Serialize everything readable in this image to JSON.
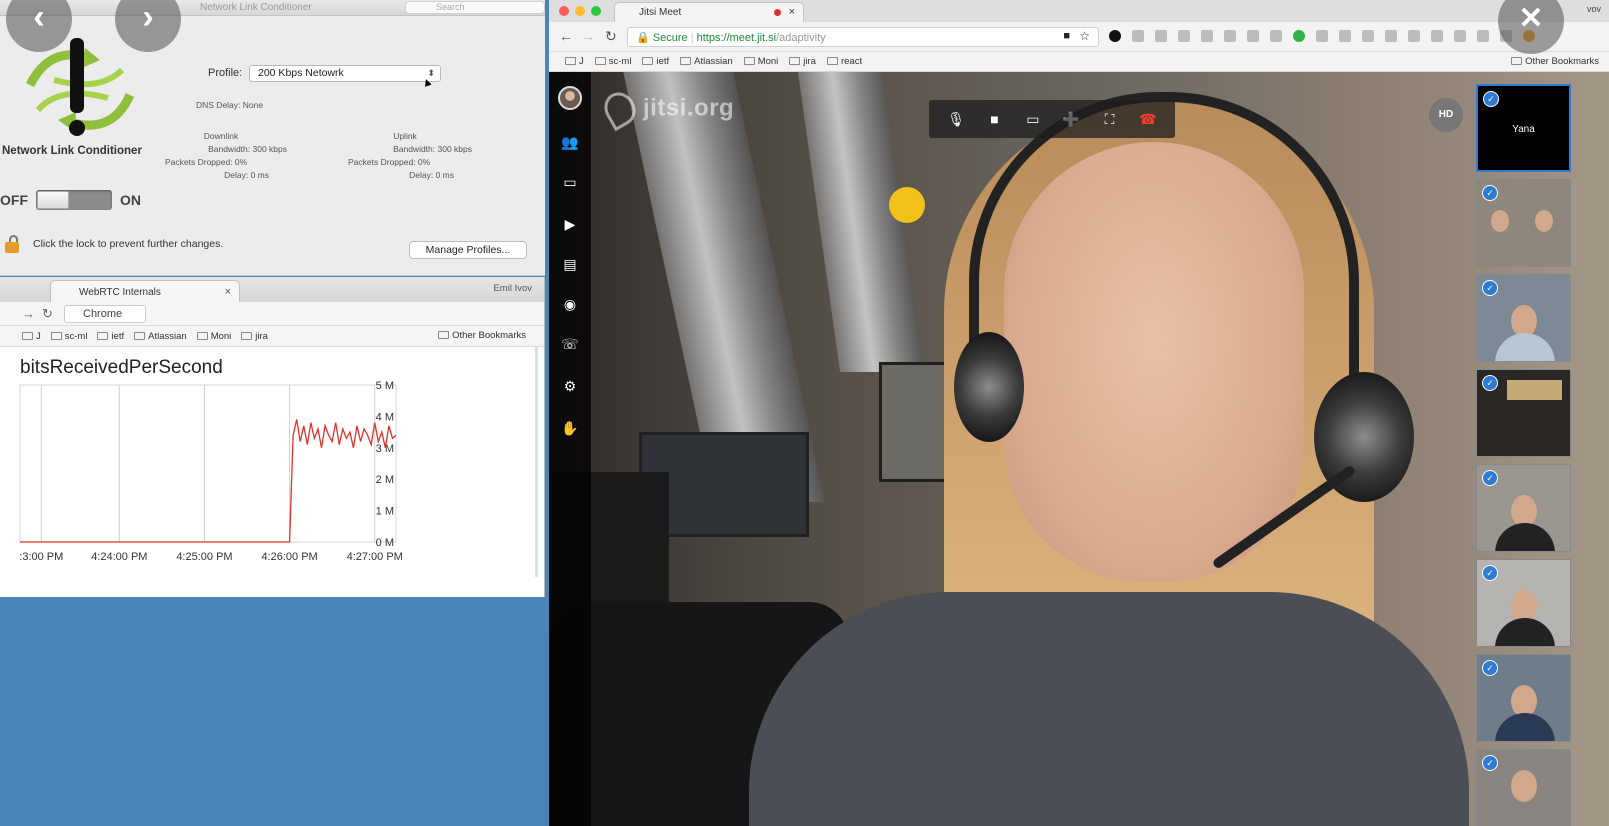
{
  "nlc": {
    "window_title": "Network Link Conditioner",
    "search_placeholder": "Search",
    "app_name": "Network Link Conditioner",
    "toggle_off": "OFF",
    "toggle_on": "ON",
    "profile_label": "Profile:",
    "profile_value": "200 Kbps Netowrk",
    "dns_delay": "DNS Delay: None",
    "downlink": {
      "title": "Downlink",
      "bandwidth": "Bandwidth: 300 kbps",
      "dropped": "Packets Dropped: 0%",
      "delay": "Delay: 0 ms"
    },
    "uplink": {
      "title": "Uplink",
      "bandwidth": "Bandwidth: 300 kbps",
      "dropped": "Packets Dropped: 0%",
      "delay": "Delay: 0 ms"
    },
    "lock_text": "Click the lock to prevent further changes.",
    "manage_profiles": "Manage Profiles..."
  },
  "webrtc": {
    "tab_title": "WebRTC Internals",
    "user": "Emil Ivov",
    "omnibox": "Chrome",
    "bookmarks": [
      "J",
      "sc-ml",
      "ietf",
      "Atlassian",
      "Moni",
      "jira"
    ],
    "other_bookmarks": "Other Bookmarks",
    "chart_title": "bitsReceivedPerSecond"
  },
  "chart_data": {
    "type": "line",
    "title": "bitsReceivedPerSecond",
    "x_tick_labels": [
      ":3:00 PM",
      "4:24:00 PM",
      "4:25:00 PM",
      "4:26:00 PM",
      "4:27:00 PM"
    ],
    "y_tick_labels": [
      "0 M",
      "1 M",
      "2 M",
      "3 M",
      "4 M",
      "5 M"
    ],
    "ylim": [
      0,
      5
    ],
    "grid": true,
    "series": [
      {
        "color": "#e0322b",
        "x": [
          0,
          0.5,
          1,
          1.5,
          2,
          2.5,
          3,
          3.5,
          3.8,
          3.85,
          3.9,
          3.95,
          4.0,
          4.05,
          4.1,
          4.15,
          4.2,
          4.25,
          4.3,
          4.35,
          4.4,
          4.45,
          4.5,
          4.55,
          4.6,
          4.65,
          4.7,
          4.75,
          4.8,
          4.85,
          4.9,
          4.95,
          5.0,
          5.05,
          5.1,
          5.15,
          5.2,
          5.25,
          5.3
        ],
        "values": [
          0,
          0,
          0,
          0,
          0,
          0,
          0,
          0,
          0,
          3.4,
          3.9,
          3.2,
          3.7,
          3.1,
          3.8,
          3.3,
          3.6,
          3.0,
          3.7,
          3.4,
          3.2,
          3.8,
          3.1,
          3.6,
          3.3,
          3.5,
          3.0,
          3.7,
          3.2,
          3.6,
          3.4,
          3.1,
          3.8,
          3.2,
          3.5,
          3.0,
          3.7,
          3.3,
          3.4
        ]
      }
    ]
  },
  "jitsi": {
    "tab_title": "Jitsi Meet",
    "user": "vov",
    "secure": "Secure",
    "url_host": "https://meet.jit.si",
    "url_path": "/adaptivity",
    "bookmarks": [
      "J",
      "sc-ml",
      "ietf",
      "Atlassian",
      "Moni",
      "jira",
      "react"
    ],
    "other_bookmarks": "Other Bookmarks",
    "watermark": "jitsi.org",
    "hd_badge": "HD",
    "thumbnails": [
      {
        "name": "Yana"
      },
      {
        "name": ""
      },
      {
        "name": ""
      },
      {
        "name": ""
      },
      {
        "name": ""
      },
      {
        "name": ""
      },
      {
        "name": ""
      },
      {
        "name": ""
      }
    ]
  },
  "overlay": {
    "prev_icon": "‹",
    "next_icon": "›",
    "close_icon": "✕"
  },
  "colors": {
    "desktop_blue": "#4a84b9",
    "accent_blue": "#2d7bd2",
    "hangup_red": "#ff3b30",
    "chart_line": "#e0322b"
  }
}
